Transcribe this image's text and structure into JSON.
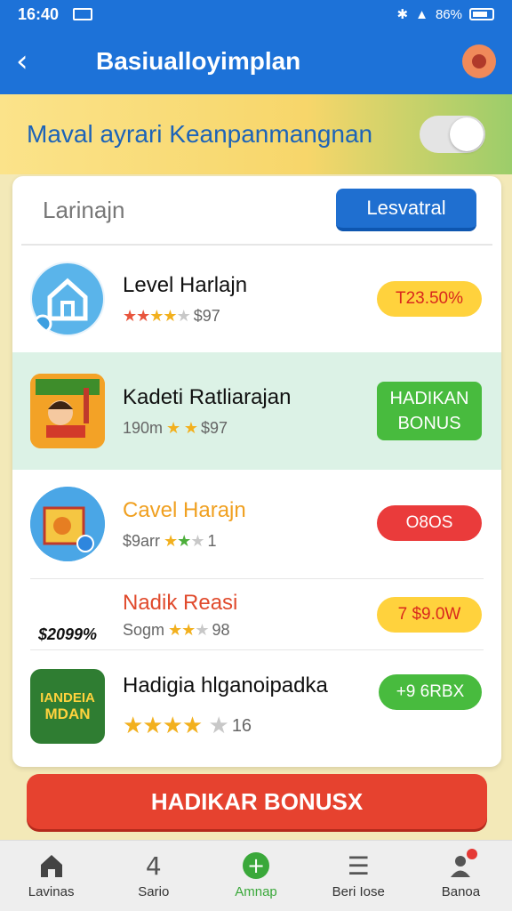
{
  "status": {
    "time": "16:40",
    "battery": "86%"
  },
  "appbar": {
    "title": "Basiualloyimplan",
    "back_icon": "chevron-left-icon"
  },
  "banner": {
    "title": "Maval ayrari Keanpanmangnan",
    "toggle_on": true
  },
  "tabs": {
    "label": "Larinajn",
    "button": "Lesvatral"
  },
  "items": [
    {
      "name": "Level Harlajn",
      "meta": "$97",
      "pill": "T23.50%",
      "pill_style": "yellow",
      "name_color": "#111111"
    },
    {
      "name": "Kadeti Ratliarajan",
      "meta_prefix": "190m",
      "meta": "$97",
      "pill_line1": "HADIKAN",
      "pill_line2": "BONUS",
      "pill_style": "greenbox",
      "name_color": "#111111"
    },
    {
      "name": "Cavel Harajn",
      "meta_prefix": "$9arr",
      "meta": "1",
      "pill": "O8OS",
      "pill_style": "red",
      "name_color": "#f0a020"
    },
    {
      "name": "Nadik Reasi",
      "meta_prefix": "Sogm",
      "meta": "98",
      "thumb_text": "$2099%",
      "pill": "7 $9.0W",
      "pill_style": "yellow",
      "name_color": "#e04a2c"
    },
    {
      "name": "Hadigia hlganoipadka",
      "meta": "16",
      "thumb_line1": "IANDEIA",
      "thumb_line2": "MDAN",
      "pill": "+9 6RBX",
      "pill_style": "green",
      "name_color": "#111111"
    }
  ],
  "cta": {
    "label": "HADIKAR BONUSX"
  },
  "nav": [
    {
      "label": "Lavinas",
      "icon": "home-icon"
    },
    {
      "label": "Sario",
      "icon": "four-icon",
      "glyph": "4"
    },
    {
      "label": "Amnap",
      "icon": "add-circle-icon",
      "glyph": "+"
    },
    {
      "label": "Beri Iose",
      "icon": "list-box-icon",
      "glyph": "☰"
    },
    {
      "label": "Banoa",
      "icon": "profile-icon"
    }
  ]
}
